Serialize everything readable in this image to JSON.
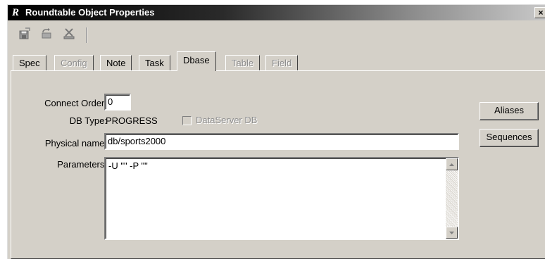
{
  "window": {
    "title": "Roundtable Object Properties",
    "close_glyph": "×",
    "app_glyph": "R"
  },
  "toolbar": {
    "icons": [
      "save-icon",
      "undo-icon",
      "delete-icon"
    ]
  },
  "tabs": [
    {
      "label": "Spec",
      "enabled": true
    },
    {
      "label": "Config",
      "enabled": false
    },
    {
      "label": "Note",
      "enabled": true
    },
    {
      "label": "Task",
      "enabled": true
    },
    {
      "label": "Dbase",
      "enabled": true,
      "active": true
    },
    {
      "label": "Table",
      "enabled": false
    },
    {
      "label": "Field",
      "enabled": false
    }
  ],
  "dbase": {
    "connect_order_label": "Connect Order:",
    "connect_order_value": "0",
    "db_type_label": "DB Type:",
    "db_type_value": "PROGRESS",
    "dataserver_label": "DataServer DB",
    "dataserver_checked": false,
    "physical_name_label": "Physical name:",
    "physical_name_value": "db/sports2000",
    "parameters_label": "Parameters:",
    "parameters_value": "-U \"\" -P \"\"",
    "aliases_button": "Aliases",
    "sequences_button": "Sequences"
  },
  "colors": {
    "face": "#d4d0c8",
    "disabled_text": "#8f8f8f",
    "title_start": "#000000",
    "title_end": "#c8c8c8"
  }
}
